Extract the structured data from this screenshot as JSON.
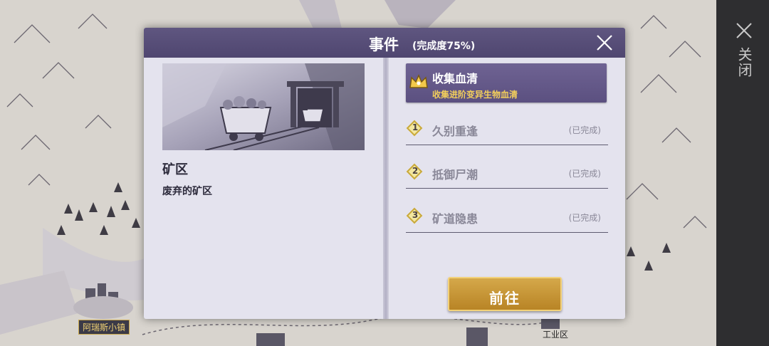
{
  "map": {
    "town_label": "阿瑞斯小镇",
    "industrial_label": "工业区"
  },
  "side": {
    "close_label": "关闭",
    "close_icon": "close-icon"
  },
  "dialog": {
    "title": "事件",
    "completion": "(完成度75%)",
    "close_icon": "close-icon",
    "place": {
      "name": "矿区",
      "description": "废弃的矿区",
      "scene_icon": "mine-cart-illustration"
    },
    "active_task": {
      "title": "收集血清",
      "subtitle": "收集进阶变异生物血清",
      "icon": "crown-icon"
    },
    "tasks": [
      {
        "num": "1",
        "label": "久别重逢",
        "status": "(已完成)"
      },
      {
        "num": "2",
        "label": "抵御尸潮",
        "status": "(已完成)"
      },
      {
        "num": "3",
        "label": "矿道隐患",
        "status": "(已完成)"
      }
    ],
    "go_label": "前往"
  },
  "colors": {
    "header": "#574e78",
    "accent_gold": "#f3cf5b",
    "button_gold": "#c8953a"
  }
}
